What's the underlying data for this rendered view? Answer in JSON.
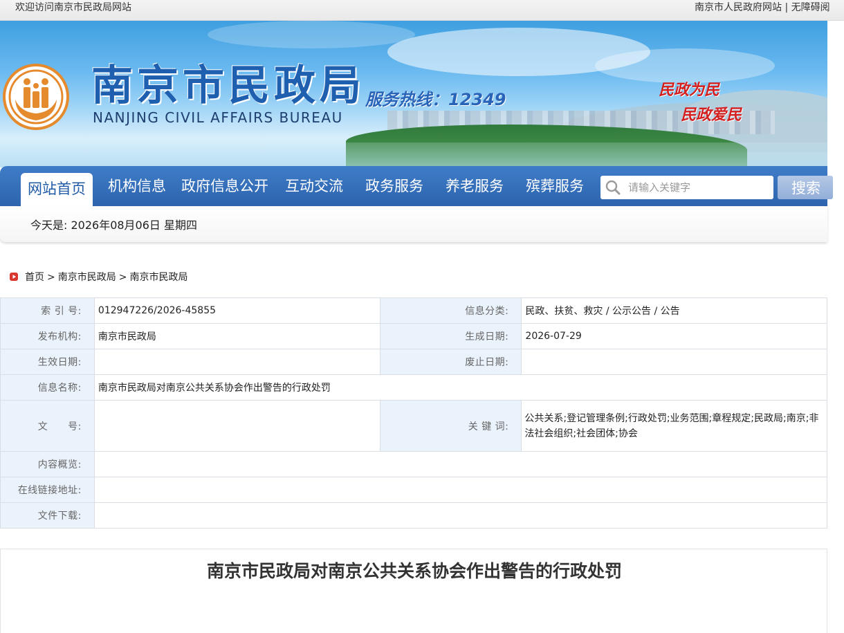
{
  "topbar": {
    "welcome": "欢迎访问南京市民政局网站",
    "gov_link": "南京市人民政府网站",
    "divider": "|",
    "accessibility_link": "无障碍阅"
  },
  "header": {
    "title_cn": "南京市民政局",
    "title_en": "NANJING CIVIL AFFAIRS BUREAU",
    "hotline": "服务热线：12349",
    "slogan_1": "民政为民",
    "slogan_2": "民政爱民",
    "colors": {
      "title": "#1e5fb0",
      "slogan": "#d41f1f",
      "logo": "#e58a2d"
    }
  },
  "nav": {
    "items": [
      {
        "label": "网站首页",
        "active": true
      },
      {
        "label": "机构信息"
      },
      {
        "label": "政府信息公开"
      },
      {
        "label": "互动交流"
      },
      {
        "label": "政务服务"
      },
      {
        "label": "养老服务"
      },
      {
        "label": "殡葬服务"
      }
    ],
    "search_placeholder": "请输入关键字",
    "search_button": "搜索",
    "colors": {
      "bar": "#2d64ad"
    }
  },
  "datebar": {
    "text": "今天是: 2026年08月06日 星期四"
  },
  "breadcrumb": {
    "icon": "play-icon",
    "items": [
      "首页",
      "南京市民政局",
      "南京市民政局"
    ],
    "sep": ">"
  },
  "info": {
    "index_label": "索 引 号:",
    "index_value": "012947226/2026-45855",
    "category_label": "信息分类:",
    "category_value": "民政、扶贫、救灾 / 公示公告 / 公告",
    "org_label": "发布机构:",
    "org_value": "南京市民政局",
    "created_label": "生成日期:",
    "created_value": "2026-07-29",
    "effective_label": "生效日期:",
    "effective_value": "",
    "expire_label": "废止日期:",
    "expire_value": "",
    "name_label": "信息名称:",
    "name_value": "南京市民政局对南京公共关系协会作出警告的行政处罚",
    "docno_label": "文　　号:",
    "docno_value": "",
    "keywords_label": "关 键 词:",
    "keywords_value": "公共关系;登记管理条例;行政处罚;业务范围;章程规定;民政局;南京;非法社会组织;社会团体;协会",
    "summary_label": "内容概览:",
    "summary_value": "",
    "link_label": "在线链接地址:",
    "link_value": "",
    "download_label": "文件下载:",
    "download_value": ""
  },
  "article": {
    "title": "南京市民政局对南京公共关系协会作出警告的行政处罚"
  }
}
